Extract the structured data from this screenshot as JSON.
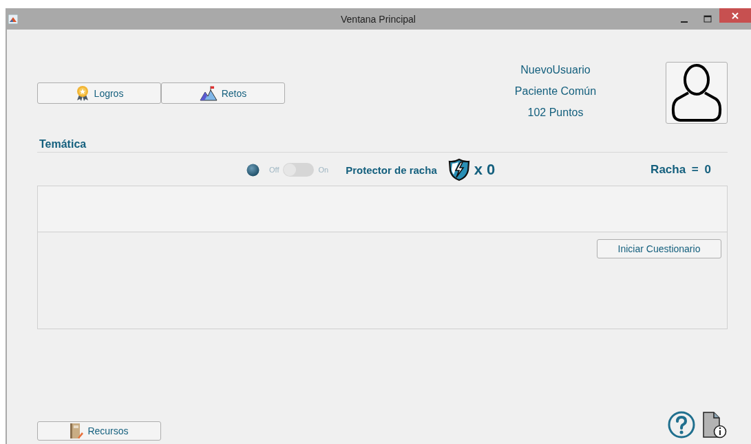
{
  "window": {
    "title": "Ventana Principal"
  },
  "nav_buttons": [
    {
      "label": "Logros",
      "kind": "medal"
    },
    {
      "label": "Retos",
      "kind": "mountain"
    }
  ],
  "user": {
    "name": "NuevoUsuario",
    "role": "Paciente Común",
    "points": "102 Puntos"
  },
  "section": {
    "title": "Temática"
  },
  "streak_protector": {
    "toggle": {
      "on": false,
      "off_label": "Off",
      "on_label": "On"
    },
    "label": "Protector de racha",
    "count": "x 0"
  },
  "streak": {
    "label": "Racha =",
    "value": "0"
  },
  "quiz_button": "Iniciar Cuestionario",
  "resources_button": "Recursos"
}
